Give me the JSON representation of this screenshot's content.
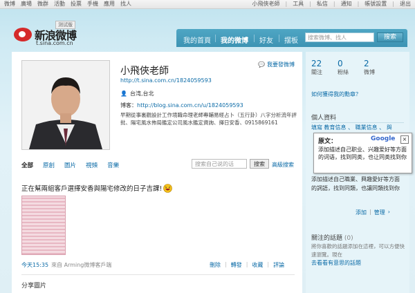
{
  "topbar": {
    "left_items": [
      "微博",
      "廣場",
      "微群",
      "活動",
      "投票",
      "手機",
      "應用",
      "找人"
    ],
    "right_items": [
      "小飛俠老師",
      "工具",
      "私信",
      "通知",
      "帳號設置",
      "退出"
    ]
  },
  "logo": {
    "brand": "新浪微博",
    "domain": "t.sina.com.cn",
    "beta": "测试版"
  },
  "nav": {
    "tabs": [
      "我的首頁",
      "我的微博",
      "好友",
      "摆板"
    ],
    "search_placeholder": "搜索微博、找人",
    "search_button": "搜索"
  },
  "profile": {
    "name": "小飛俠老師",
    "send_label": "我要發微博",
    "url": "http://t.sina.com.cn/1824059593",
    "location": "台湾,台北",
    "blog_label": "博客：",
    "blog_url": "http://blog.sina.com.cn/u/1824059593",
    "bio": "早期從事裏觀設計工作境職命理老師專輔易經占卜（五行卦）八字分析流年評批、陽宅風水佈局鑑定公司風水鑑定資詢、擇日安香、0915869161"
  },
  "filters": {
    "items": [
      "全部",
      "原創",
      "圖片",
      "視頻",
      "音樂"
    ],
    "search_placeholder": "搜索自己说的话",
    "search_button": "搜索",
    "advanced": "高級搜索"
  },
  "post": {
    "text": "正在幫兩組客戶選擇安香與陽宅修改的日子吉課!",
    "time": "今天15:35",
    "source": "來自 Arming微博客戶端",
    "actions": [
      "刪除",
      "轉發",
      "收藏",
      "評論"
    ]
  },
  "share_label": "分享圖片",
  "side": {
    "stats": [
      {
        "n": "22",
        "l": "關注"
      },
      {
        "n": "0",
        "l": "粉絲"
      },
      {
        "n": "2",
        "l": "微博"
      }
    ],
    "howto": "如何獲得我的勳章？",
    "personal_title": "個人資料",
    "info_line": "填寫 教育信息 、 職業信息 、 與",
    "desc": "添加描述自己職業、興趣愛好等方面的詞語，找到同類，也讓同類找到你",
    "add": "添加",
    "manage": "管理",
    "topics_title": "關注的話題",
    "topics_count": "(0)",
    "topics_desc": "將你喜歡的話題添加在這裡，可以方便快速瀏覽。現在",
    "topics_link": "去看看有意思的話題"
  },
  "gpopup": {
    "title": "原文：",
    "brand": "Google",
    "text": "添加描述自己职业、兴趣爱好等方面的词语，找到同类，也让同类找到你"
  }
}
